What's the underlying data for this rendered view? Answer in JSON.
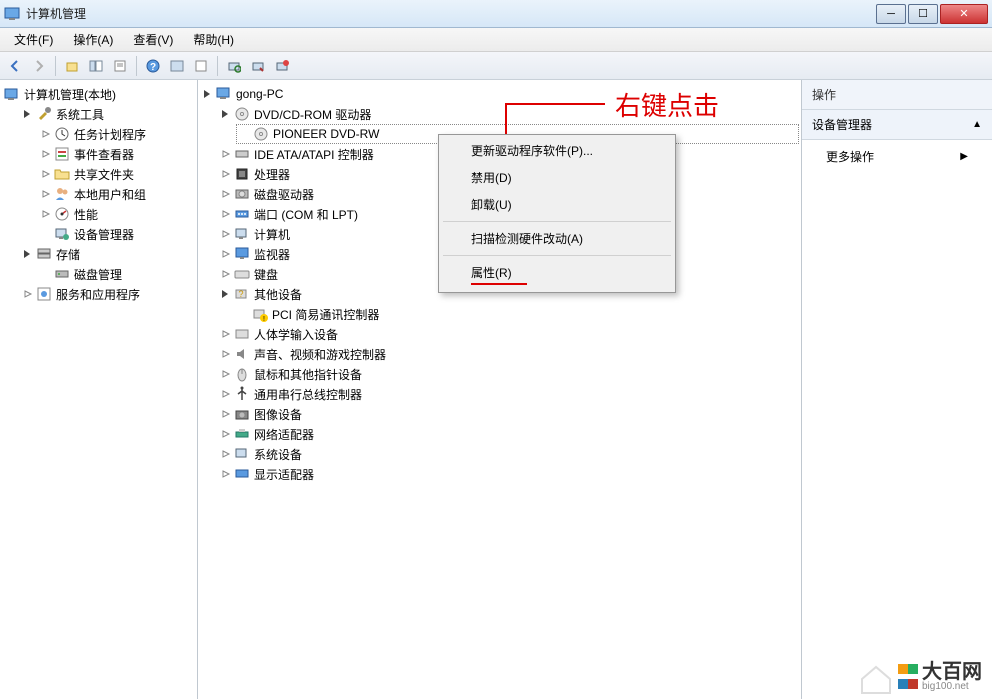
{
  "window": {
    "title": "计算机管理"
  },
  "menus": {
    "file": "文件(F)",
    "action": "操作(A)",
    "view": "查看(V)",
    "help": "帮助(H)"
  },
  "left_tree": {
    "root": "计算机管理(本地)",
    "system_tools": "系统工具",
    "task_scheduler": "任务计划程序",
    "event_viewer": "事件查看器",
    "shared_folders": "共享文件夹",
    "local_users": "本地用户和组",
    "performance": "性能",
    "device_manager": "设备管理器",
    "storage": "存储",
    "disk_management": "磁盘管理",
    "services_apps": "服务和应用程序"
  },
  "center_tree": {
    "root": "gong-PC",
    "dvd_group": "DVD/CD-ROM 驱动器",
    "dvd_device": "PIONEER DVD-RW",
    "ide": "IDE ATA/ATAPI 控制器",
    "cpu": "处理器",
    "disk_drives": "磁盘驱动器",
    "ports": "端口 (COM 和 LPT)",
    "computer": "计算机",
    "monitor": "监视器",
    "keyboard": "键盘",
    "other": "其他设备",
    "pci": "PCI 简易通讯控制器",
    "hid": "人体学输入设备",
    "sound": "声音、视频和游戏控制器",
    "mouse": "鼠标和其他指针设备",
    "usb": "通用串行总线控制器",
    "imaging": "图像设备",
    "network": "网络适配器",
    "system": "系统设备",
    "display": "显示适配器"
  },
  "context_menu": {
    "update_driver": "更新驱动程序软件(P)...",
    "disable": "禁用(D)",
    "uninstall": "卸载(U)",
    "scan": "扫描检测硬件改动(A)",
    "properties": "属性(R)"
  },
  "right_panel": {
    "header": "操作",
    "section": "设备管理器",
    "more_actions": "更多操作"
  },
  "annotation": {
    "text": "右键点击"
  },
  "watermark": {
    "brand": "大百网",
    "url": "big100.net"
  }
}
